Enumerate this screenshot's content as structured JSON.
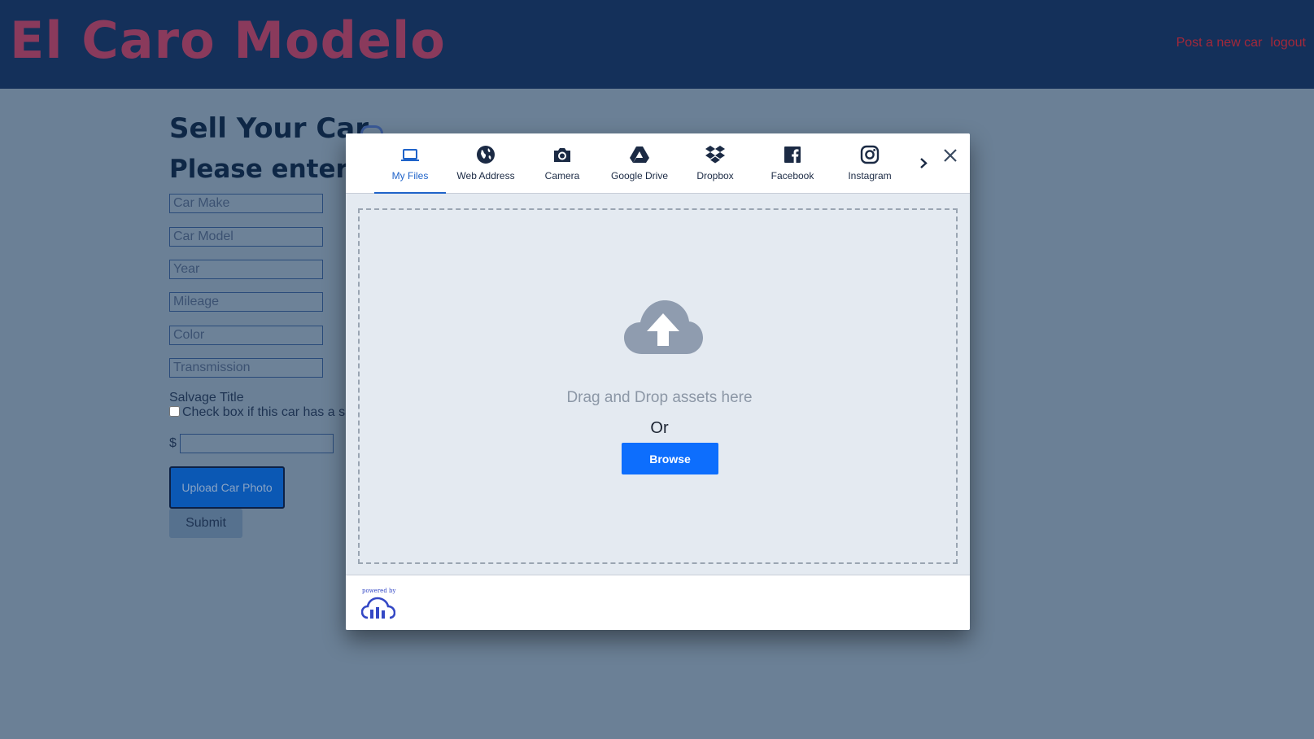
{
  "header": {
    "brand": "El Caro Modelo",
    "nav": {
      "post_new_car": "Post a new car",
      "separator": "|",
      "logout": "logout"
    }
  },
  "form": {
    "title": "Sell Your Car",
    "subtitle": "Please enter your car details",
    "fields": {
      "make": "Car Make",
      "model": "Car Model",
      "year": "Year",
      "mileage": "Mileage",
      "color": "Color",
      "transmission": "Transmission"
    },
    "salvage_label": "Salvage Title",
    "salvage_checkbox_text": "Check box if this car has a salvage title",
    "currency_symbol": "$",
    "price_value": "",
    "upload_label": "Upload Car Photo",
    "submit_label": "Submit"
  },
  "upload_widget": {
    "tabs": [
      {
        "label": "My Files",
        "icon": "laptop-icon",
        "active": true
      },
      {
        "label": "Web Address",
        "icon": "globe-icon",
        "active": false
      },
      {
        "label": "Camera",
        "icon": "camera-icon",
        "active": false
      },
      {
        "label": "Google Drive",
        "icon": "google-drive-icon",
        "active": false
      },
      {
        "label": "Dropbox",
        "icon": "dropbox-icon",
        "active": false
      },
      {
        "label": "Facebook",
        "icon": "facebook-icon",
        "active": false
      },
      {
        "label": "Instagram",
        "icon": "instagram-icon",
        "active": false
      }
    ],
    "drop_text": "Drag and Drop assets here",
    "or_text": "Or",
    "browse_label": "Browse",
    "powered_by": "powered by"
  },
  "colors": {
    "header_bg": "#14305a",
    "brand": "#8a3a5c",
    "nav_link": "#a3283a",
    "accent": "#1f63c9",
    "browse": "#0d6efd",
    "overlay_page": "#6b8096"
  }
}
